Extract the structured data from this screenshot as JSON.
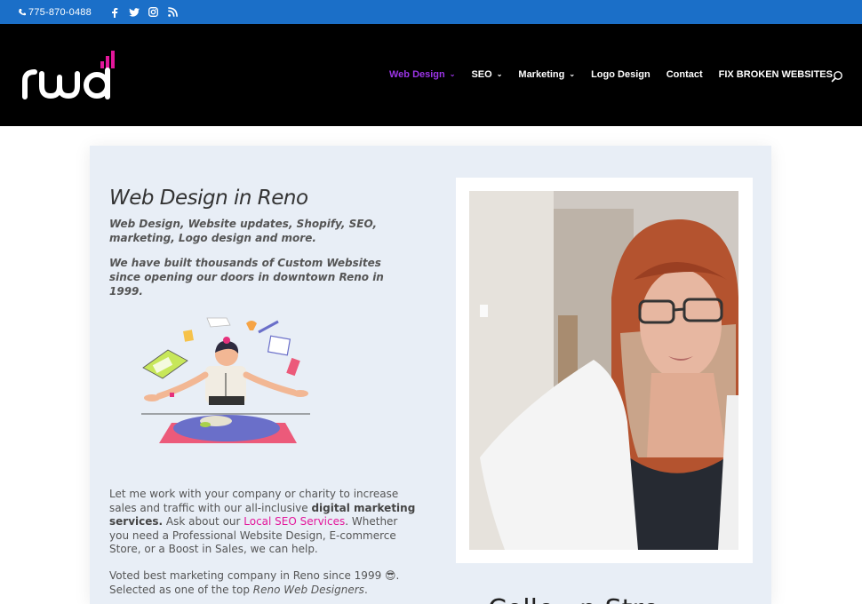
{
  "topbar": {
    "phone": "775-870-0488",
    "socials": [
      "facebook-icon",
      "twitter-icon",
      "instagram-icon",
      "rss-icon"
    ],
    "color": "#1b6fc8"
  },
  "header": {
    "logo_text": "rwd",
    "nav": [
      {
        "label": "Web Design",
        "dropdown": true,
        "active": true
      },
      {
        "label": "SEO",
        "dropdown": true,
        "active": false
      },
      {
        "label": "Marketing",
        "dropdown": true,
        "active": false
      },
      {
        "label": "Logo Design",
        "dropdown": false,
        "active": false
      },
      {
        "label": "Contact",
        "dropdown": false,
        "active": false
      },
      {
        "label": "FIX BROKEN WEBSITES",
        "dropdown": false,
        "active": false
      }
    ],
    "active_color": "#9b34e6"
  },
  "content": {
    "heading": "Web Design in Reno",
    "intro": "Web Design, Website updates, Shopify, SEO, marketing, Logo design and more.",
    "intro2": "We have built thousands of Custom Websites since opening our doors in downtown Reno in 1999.",
    "para1_a": "Let me work with your company or charity to increase sales and traffic with our all-inclusive ",
    "para1_b": "digital marketing services.",
    "para1_c": " Ask about our ",
    "para1_link": "Local SEO Services",
    "para1_d": ".  Whether you need a Professional Website Design, E-commerce Store, or a Boost in Sales, we can help.",
    "para2_a": "Voted best marketing company in Reno since 1999 😎.",
    "para2_b": "Selected as one of the top ",
    "para2_c": "Reno Web Designers",
    "para2_d": ".",
    "partial_heading": "Colle...n Stre..."
  }
}
